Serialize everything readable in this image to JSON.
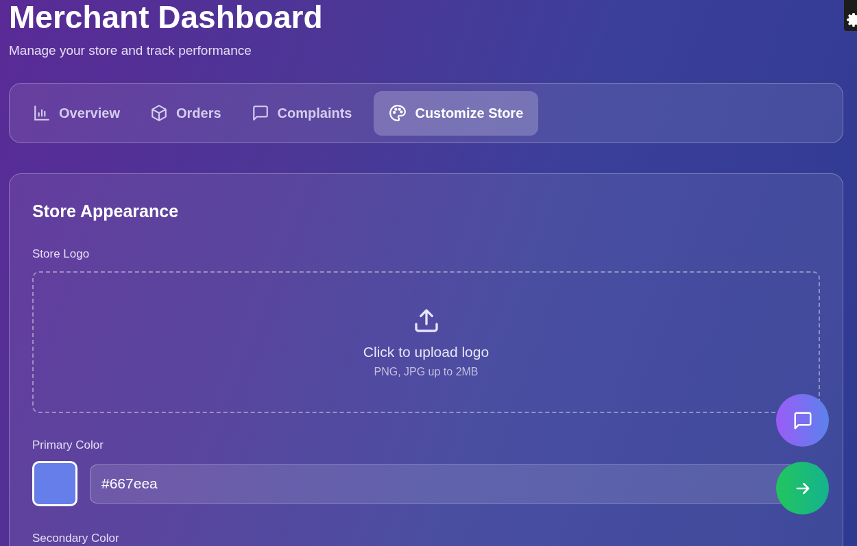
{
  "header": {
    "title": "Merchant Dashboard",
    "subtitle": "Manage your store and track performance"
  },
  "tabs": [
    {
      "label": "Overview",
      "selected": false
    },
    {
      "label": "Orders",
      "selected": false
    },
    {
      "label": "Complaints",
      "selected": false
    },
    {
      "label": "Customize Store",
      "selected": true
    }
  ],
  "panel": {
    "title": "Store Appearance",
    "logo": {
      "label": "Store Logo",
      "prompt": "Click to upload logo",
      "hint": "PNG, JPG up to 2MB"
    },
    "color_fields": [
      {
        "label": "Primary Color",
        "value": "#667eea",
        "color": "#667eea"
      },
      {
        "label": "Secondary Color"
      }
    ]
  }
}
